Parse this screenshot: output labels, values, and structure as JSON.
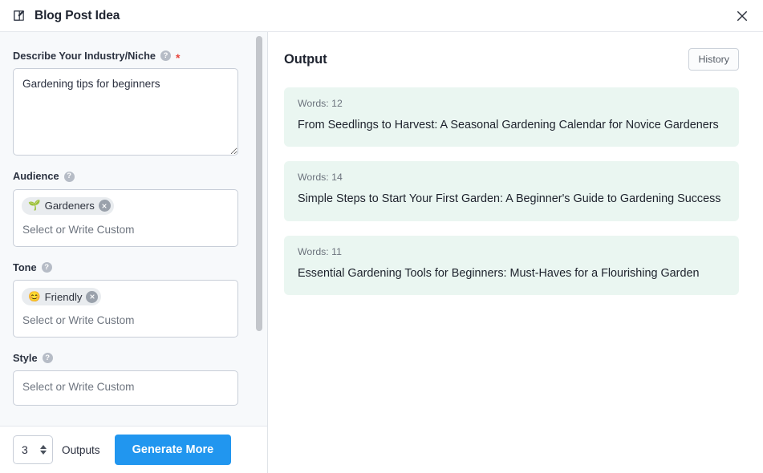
{
  "header": {
    "title": "Blog Post Idea",
    "edit_icon": "edit-square-icon",
    "close_icon": "close-icon"
  },
  "form": {
    "niche": {
      "label": "Describe Your Industry/Niche",
      "help": "?",
      "required_mark": "*",
      "value": "Gardening tips for beginners"
    },
    "audience": {
      "label": "Audience",
      "help": "?",
      "placeholder": "Select or Write Custom",
      "tags": [
        {
          "emoji": "🌱",
          "label": "Gardeners",
          "remove": "×"
        }
      ]
    },
    "tone": {
      "label": "Tone",
      "help": "?",
      "placeholder": "Select or Write Custom",
      "tags": [
        {
          "emoji": "😊",
          "label": "Friendly",
          "remove": "×"
        }
      ]
    },
    "style": {
      "label": "Style",
      "help": "?",
      "placeholder": "Select or Write Custom"
    }
  },
  "footer": {
    "outputs_count": "3",
    "outputs_label": "Outputs",
    "generate_label": "Generate More"
  },
  "output": {
    "title": "Output",
    "history_label": "History",
    "cards": [
      {
        "words_label": "Words: 12",
        "text": "From Seedlings to Harvest: A Seasonal Gardening Calendar for Novice Gardeners"
      },
      {
        "words_label": "Words: 14",
        "text": "Simple Steps to Start Your First Garden: A Beginner's Guide to Gardening Success"
      },
      {
        "words_label": "Words: 11",
        "text": "Essential Gardening Tools for Beginners: Must-Haves for a Flourishing Garden"
      }
    ]
  },
  "colors": {
    "accent_blue": "#2196ef",
    "card_green": "#eaf6f1",
    "required_red": "#e8453c",
    "panel_bg": "#f7f9fb"
  }
}
